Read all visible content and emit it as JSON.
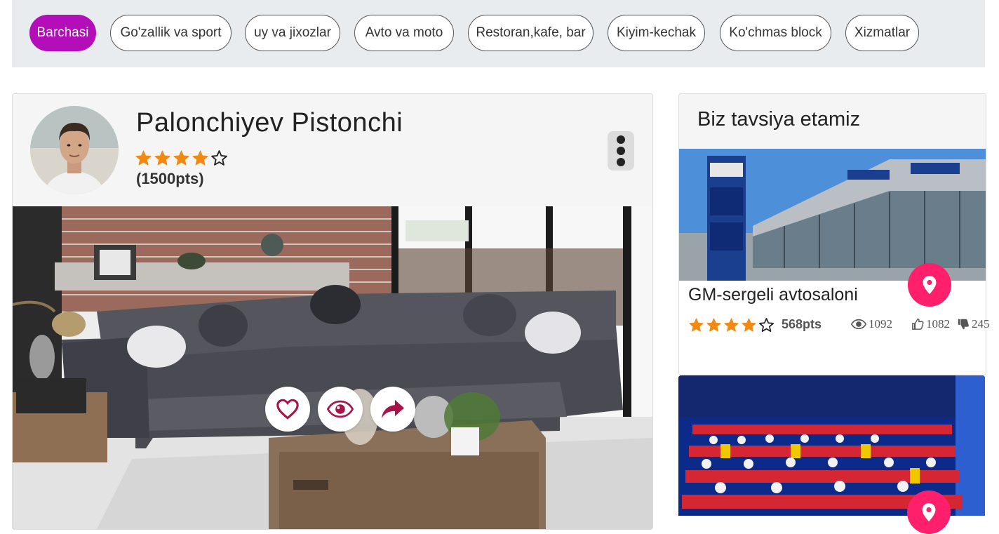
{
  "categories": [
    {
      "label": "Barchasi",
      "active": true
    },
    {
      "label": "Go'zallik va sport",
      "active": false
    },
    {
      "label": "uy va jixozlar",
      "active": false
    },
    {
      "label": "Avto va moto",
      "active": false
    },
    {
      "label": "Restoran,kafe, bar",
      "active": false
    },
    {
      "label": "Kiyim-kechak",
      "active": false
    },
    {
      "label": "Ko'chmas block",
      "active": false
    },
    {
      "label": "Xizmatlar",
      "active": false
    }
  ],
  "post": {
    "author": "Palonchiyev Pistonchi",
    "rating": 4,
    "rating_max": 5,
    "points": "(1500pts)",
    "actions": [
      "heart-icon",
      "eye-icon",
      "share-icon"
    ],
    "accent_color": "#a8134a"
  },
  "recommend": {
    "title": "Biz tavsiya etamiz",
    "items": [
      {
        "name": "GM-sergeli avtosaloni",
        "rating": 4,
        "rating_max": 5,
        "points": "568pts",
        "views": "1092",
        "likes": "1082",
        "dislikes": "245"
      }
    ]
  },
  "colors": {
    "active_pill": "#b40eb9",
    "star": "#f08a13",
    "pin": "#ff1f6a"
  }
}
